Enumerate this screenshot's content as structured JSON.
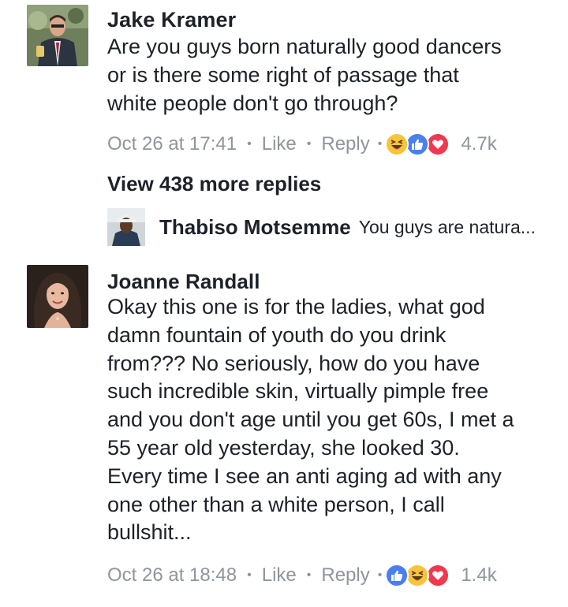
{
  "comments": [
    {
      "author": "Jake Kramer",
      "body_lines": [
        "Are you guys born naturally good dancers",
        "or is there some right of passage that",
        "white people don't go through?"
      ],
      "timestamp": "Oct 26 at 17:41",
      "like_label": "Like",
      "reply_label": "Reply",
      "reactions": [
        "haha-icon",
        "like-icon",
        "love-icon"
      ],
      "reaction_count": "4.7k"
    },
    {
      "author": "Joanne Randall",
      "body_lines": [
        "Okay this one is for the ladies, what god",
        "damn fountain of youth do you drink",
        "from??? No seriously, how do you have",
        "such incredible skin, virtually pimple free",
        "and you don't age until you get 60s, I met a",
        "55 year old yesterday, she looked 30.",
        "Every time I see an anti aging ad with any",
        "one other than a white person, I call",
        "bullshit..."
      ],
      "timestamp": "Oct 26 at 18:48",
      "like_label": "Like",
      "reply_label": "Reply",
      "reactions": [
        "like-icon",
        "haha-icon",
        "love-icon"
      ],
      "reaction_count": "1.4k"
    }
  ],
  "view_more_replies": "View 438 more replies",
  "reply_preview": {
    "author": "Thabiso Motsemme",
    "snippet": "You guys are natura..."
  },
  "colors": {
    "text": "#1d2129",
    "meta": "#90949c",
    "like": "#4a7ff0",
    "haha": "#f7c43c",
    "love": "#f0384e"
  }
}
